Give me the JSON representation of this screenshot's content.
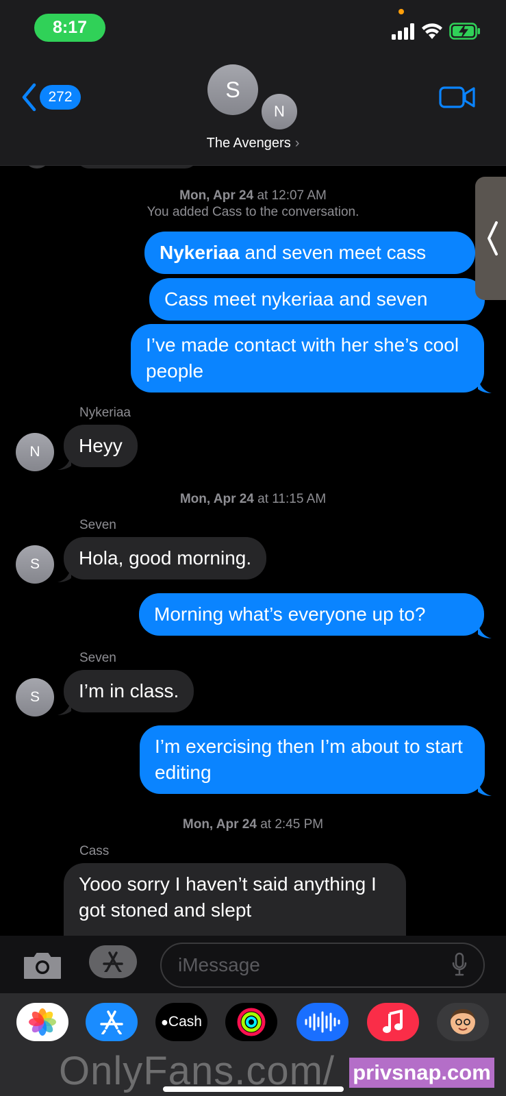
{
  "status": {
    "time": "8:17"
  },
  "header": {
    "back_count": "272",
    "avatar_main": "S",
    "avatar_second": "N",
    "title": "The Avengers",
    "title_chevron": "›"
  },
  "thread": {
    "ts1_date": "Mon, Apr 24",
    "ts1_time": " at 12:07 AM",
    "system_note": "You added Cass to the conversation.",
    "m1_bold": "Nykeriaa",
    "m1_rest": " and seven meet cass",
    "m2": "Cass meet nykeriaa and seven",
    "m3": "I’ve made contact with her she’s cool people",
    "sender1": "Nykeriaa",
    "avatar1": "N",
    "m4": "Heyy",
    "ts2_date": "Mon, Apr 24",
    "ts2_time": " at 11:15 AM",
    "sender2": "Seven",
    "avatar2": "S",
    "m5": "Hola, good morning.",
    "m6": "Morning what’s everyone up to?",
    "sender3": "Seven",
    "avatar3": "S",
    "m7": "I’m in class.",
    "m8": "I’m exercising then I’m about to start editing",
    "ts3_date": "Mon, Apr 24",
    "ts3_time": " at 2:45 PM",
    "sender4": "Cass",
    "m9": "Yooo sorry I haven’t said anything I got stoned and slept"
  },
  "compose": {
    "placeholder": "iMessage"
  },
  "drawer": {
    "apps": [
      "Photos",
      "App Store",
      "Cash",
      "Activity",
      "Voice",
      "Music",
      "Memoji"
    ],
    "cash_label": "Cash",
    "watermark": "OnlyFans.com/",
    "watermark2": "privsnap.com"
  },
  "colors": {
    "bubble_out": "#0a84ff",
    "bubble_in": "#262628",
    "time_pill": "#30d158"
  }
}
